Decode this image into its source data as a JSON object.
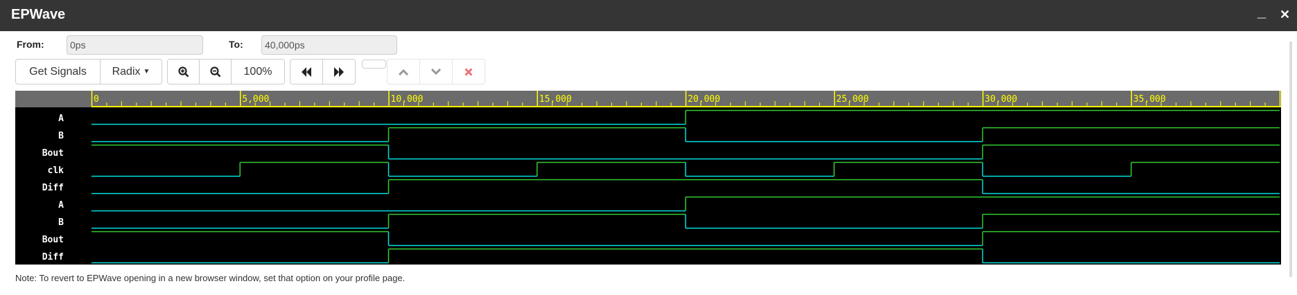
{
  "window": {
    "title": "EPWave",
    "minimize": "_",
    "close": "✕"
  },
  "range": {
    "from_label": "From:",
    "from_value": "0ps",
    "to_label": "To:",
    "to_value": "40,000ps"
  },
  "toolbar": {
    "get_signals": "Get Signals",
    "radix": "Radix",
    "zoom_level": "100%"
  },
  "colors": {
    "high": "#33cc33",
    "low": "#00e0e0",
    "ruler": "#ffff00",
    "ruler_bg": "#6b6b6b"
  },
  "timeline": {
    "start": 0,
    "end": 40000,
    "major_step": 5000,
    "minor_step": 500,
    "labels": [
      "0",
      "5,000",
      "10,000",
      "15,000",
      "20,000",
      "25,000",
      "30,000",
      "35,000"
    ]
  },
  "signals": [
    {
      "name": "A",
      "edges": [
        [
          0,
          0
        ],
        [
          20000,
          1
        ]
      ]
    },
    {
      "name": "B",
      "edges": [
        [
          0,
          0
        ],
        [
          10000,
          1
        ],
        [
          20000,
          0
        ],
        [
          30000,
          1
        ]
      ]
    },
    {
      "name": "Bout",
      "edges": [
        [
          0,
          1
        ],
        [
          10000,
          0
        ],
        [
          30000,
          1
        ]
      ]
    },
    {
      "name": "clk",
      "edges": [
        [
          0,
          0
        ],
        [
          5000,
          1
        ],
        [
          10000,
          0
        ],
        [
          15000,
          1
        ],
        [
          20000,
          0
        ],
        [
          25000,
          1
        ],
        [
          30000,
          0
        ],
        [
          35000,
          1
        ]
      ]
    },
    {
      "name": "Diff",
      "edges": [
        [
          0,
          0
        ],
        [
          10000,
          1
        ],
        [
          30000,
          0
        ]
      ]
    },
    {
      "name": "A",
      "edges": [
        [
          0,
          0
        ],
        [
          20000,
          1
        ]
      ]
    },
    {
      "name": "B",
      "edges": [
        [
          0,
          0
        ],
        [
          10000,
          1
        ],
        [
          20000,
          0
        ],
        [
          30000,
          1
        ]
      ]
    },
    {
      "name": "Bout",
      "edges": [
        [
          0,
          1
        ],
        [
          10000,
          0
        ],
        [
          30000,
          1
        ]
      ]
    },
    {
      "name": "Diff",
      "edges": [
        [
          0,
          0
        ],
        [
          10000,
          1
        ],
        [
          30000,
          0
        ]
      ]
    }
  ],
  "note": "Note: To revert to EPWave opening in a new browser window, set that option on your profile page."
}
